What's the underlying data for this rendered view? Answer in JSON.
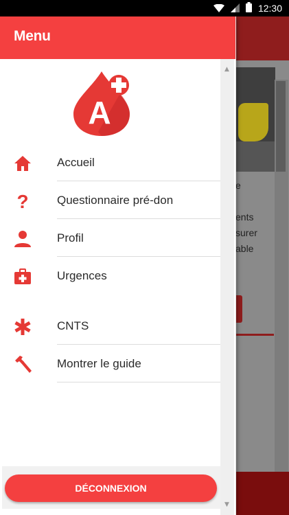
{
  "status_bar": {
    "time": "12:30",
    "icons": [
      "wifi-icon",
      "signal-icon",
      "battery-icon"
    ]
  },
  "drawer": {
    "title": "Menu",
    "logo_letter": "A",
    "items": [
      {
        "label": "Accueil",
        "icon": "home-icon"
      },
      {
        "label": "Questionnaire pré-don",
        "icon": "question-mark-icon"
      },
      {
        "label": "Profil",
        "icon": "person-icon"
      },
      {
        "label": "Urgences",
        "icon": "first-aid-kit-icon"
      },
      {
        "label": "CNTS",
        "icon": "asterisk-icon"
      },
      {
        "label": "Montrer le guide",
        "icon": "hammer-icon"
      }
    ],
    "logout_label": "DÉCONNEXION"
  },
  "background_page": {
    "text_fragments": [
      "e",
      "ents",
      "surer",
      "able"
    ]
  },
  "colors": {
    "accent": "#f44040",
    "status_bar": "#000000",
    "icon": "#e53935"
  }
}
